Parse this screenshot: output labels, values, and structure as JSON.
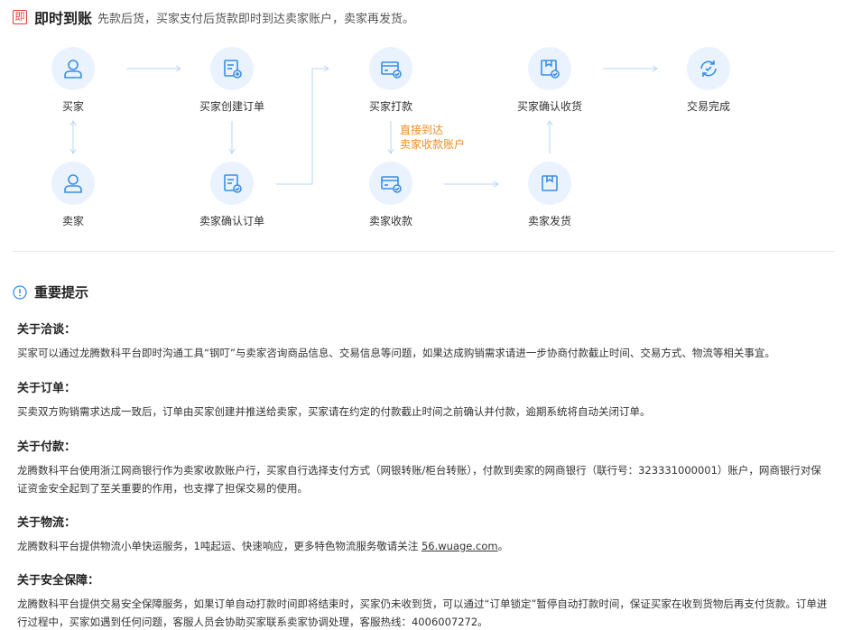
{
  "header": {
    "tag": "即",
    "title": "即时到账",
    "subtitle": "先款后货，买家支付后货款即时到达卖家账户，卖家再发货。"
  },
  "flow": {
    "nodes": {
      "buyer": "买家",
      "buyer_create_order": "买家创建订单",
      "buyer_pay": "买家打款",
      "buyer_confirm_receipt": "买家确认收货",
      "trade_complete": "交易完成",
      "seller": "卖家",
      "seller_confirm_order": "卖家确认订单",
      "seller_receive": "卖家收款",
      "seller_ship": "卖家发货"
    },
    "note_line1": "直接到达",
    "note_line2": "卖家收款账户"
  },
  "tips": {
    "title": "重要提示",
    "sections": [
      {
        "title": "关于洽谈：",
        "text": "买家可以通过龙腾数科平台即时沟通工具“钢叮”与卖家咨询商品信息、交易信息等问题，如果达成购销需求请进一步协商付款截止时间、交易方式、物流等相关事宜。"
      },
      {
        "title": "关于订单：",
        "text": "买卖双方购销需求达成一致后，订单由买家创建并推送给卖家，买家请在约定的付款截止时间之前确认并付款，逾期系统将自动关闭订单。"
      },
      {
        "title": "关于付款：",
        "text": "龙腾数科平台使用浙江网商银行作为卖家收款账户行，买家自行选择支付方式（网银转账/柜台转账），付款到卖家的网商银行（联行号：323331000001）账户，网商银行对保证资金安全起到了至关重要的作用，也支撑了担保交易的使用。"
      },
      {
        "title": "关于物流：",
        "text": "龙腾数科平台提供物流小单快运服务，1吨起运、快速响应，更多特色物流服务敬请关注 ",
        "link": "56.wuage.com",
        "text_after": "。"
      },
      {
        "title": "关于安全保障：",
        "text": "龙腾数科平台提供交易安全保障服务，如果订单自动打款时间即将结束时，买家仍未收到货，可以通过“订单锁定”暂停自动打款时间，保证买家在收到货物后再支付货款。订单进行过程中，买家如遇到任何问题，客服人员会协助买家联系卖家协调处理，客服热线：4006007272。"
      }
    ]
  },
  "colors": {
    "icon_blue": "#3a8ee6",
    "icon_bg": "#eaf3fd",
    "arrow": "#b9d4f2",
    "note_orange": "#f08c1f",
    "tag_red": "#e4393c"
  }
}
